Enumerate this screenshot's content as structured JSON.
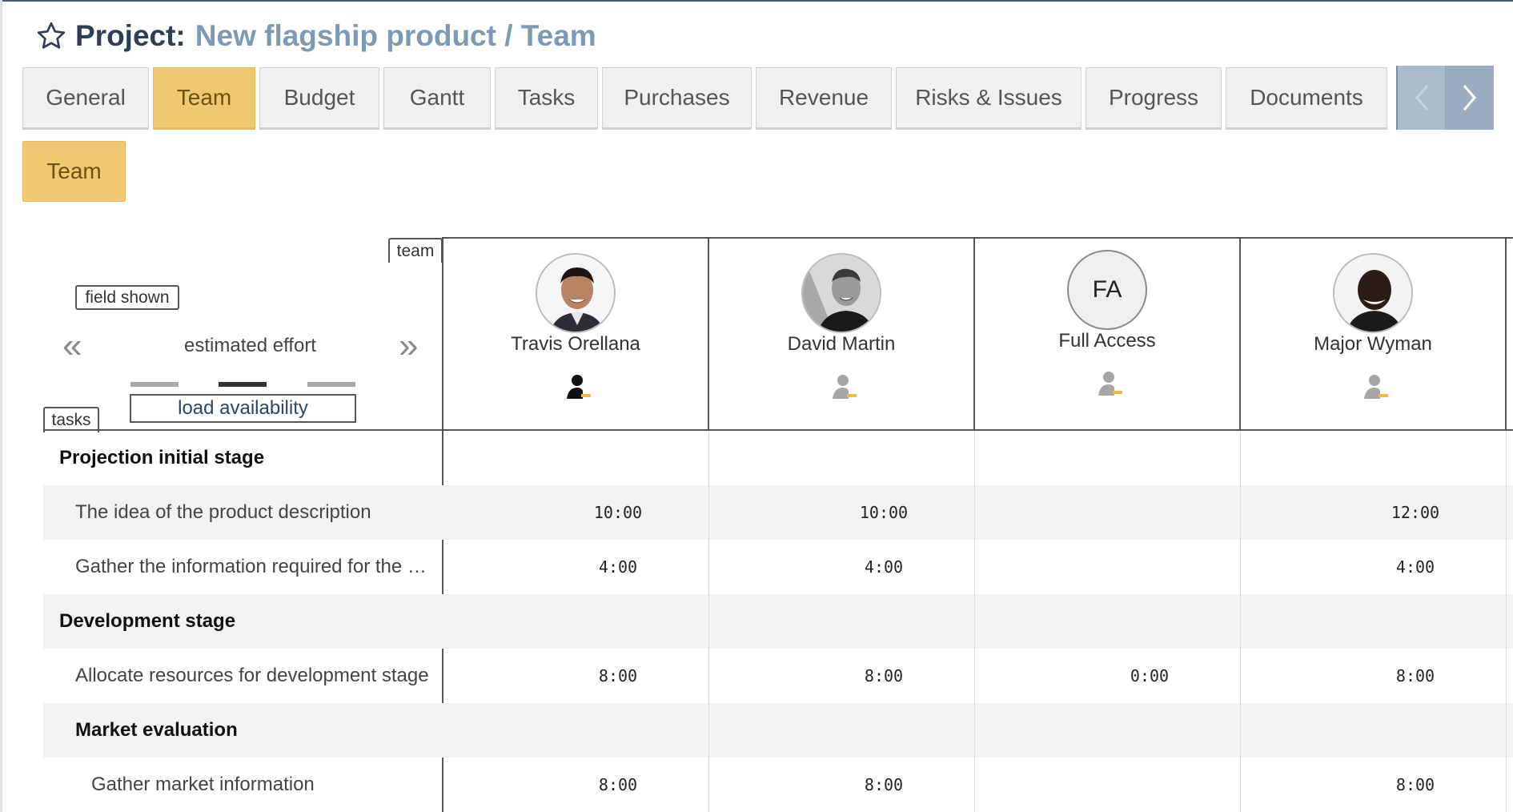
{
  "header": {
    "project_label": "Project:",
    "project_name": "New flagship product / Team",
    "star_icon": "star-outline-icon"
  },
  "tabs": [
    {
      "label": "General",
      "active": false
    },
    {
      "label": "Team",
      "active": true
    },
    {
      "label": "Budget",
      "active": false
    },
    {
      "label": "Gantt",
      "active": false
    },
    {
      "label": "Tasks",
      "active": false
    },
    {
      "label": "Purchases",
      "active": false
    },
    {
      "label": "Revenue",
      "active": false
    },
    {
      "label": "Risks & Issues",
      "active": false
    },
    {
      "label": "Progress",
      "active": false
    },
    {
      "label": "Documents",
      "active": false
    }
  ],
  "tab_nav": {
    "prev_icon": "chevron-left-icon",
    "next_icon": "chevron-right-icon"
  },
  "subtab": {
    "label": "Team"
  },
  "grid": {
    "team_label": "team",
    "tasks_label": "tasks",
    "field_shown_label": "field shown",
    "field_value": "estimated effort",
    "prev_arrow": "«",
    "next_arrow": "»",
    "load_availability": "load availability"
  },
  "members": [
    {
      "name": "Travis Orellana",
      "initials": "",
      "avatar": "photo",
      "role_icon": "user-role-icon"
    },
    {
      "name": "David Martin",
      "initials": "",
      "avatar": "photo",
      "role_icon": "user-role-icon"
    },
    {
      "name": "Full Access",
      "initials": "FA",
      "avatar": "initials",
      "role_icon": "user-role-icon"
    },
    {
      "name": "Major Wyman",
      "initials": "",
      "avatar": "photo",
      "role_icon": "user-role-icon"
    }
  ],
  "rows": [
    {
      "label": "Projection initial stage",
      "type": "group",
      "indent": 0,
      "values": [
        "",
        "",
        "",
        ""
      ]
    },
    {
      "label": "The idea of the product description",
      "type": "task",
      "indent": 1,
      "values": [
        "10:00",
        "10:00",
        "",
        "12:00"
      ]
    },
    {
      "label": "Gather the information required for the …",
      "type": "task",
      "indent": 1,
      "values": [
        "4:00",
        "4:00",
        "",
        "4:00"
      ]
    },
    {
      "label": "Development stage",
      "type": "group",
      "indent": 0,
      "values": [
        "",
        "",
        "",
        ""
      ]
    },
    {
      "label": "Allocate resources for development stage",
      "type": "task",
      "indent": 1,
      "values": [
        "8:00",
        "8:00",
        "0:00",
        "8:00"
      ]
    },
    {
      "label": "Market evaluation",
      "type": "group",
      "indent": 1,
      "values": [
        "",
        "",
        "",
        ""
      ]
    },
    {
      "label": "Gather market information",
      "type": "task",
      "indent": 2,
      "values": [
        "8:00",
        "8:00",
        "",
        "8:00"
      ]
    }
  ],
  "colors": {
    "accent_tab": "#f0c870",
    "project_name": "#7d9ab5",
    "project_label": "#2e3e55",
    "role_badge": "#f0b940"
  }
}
